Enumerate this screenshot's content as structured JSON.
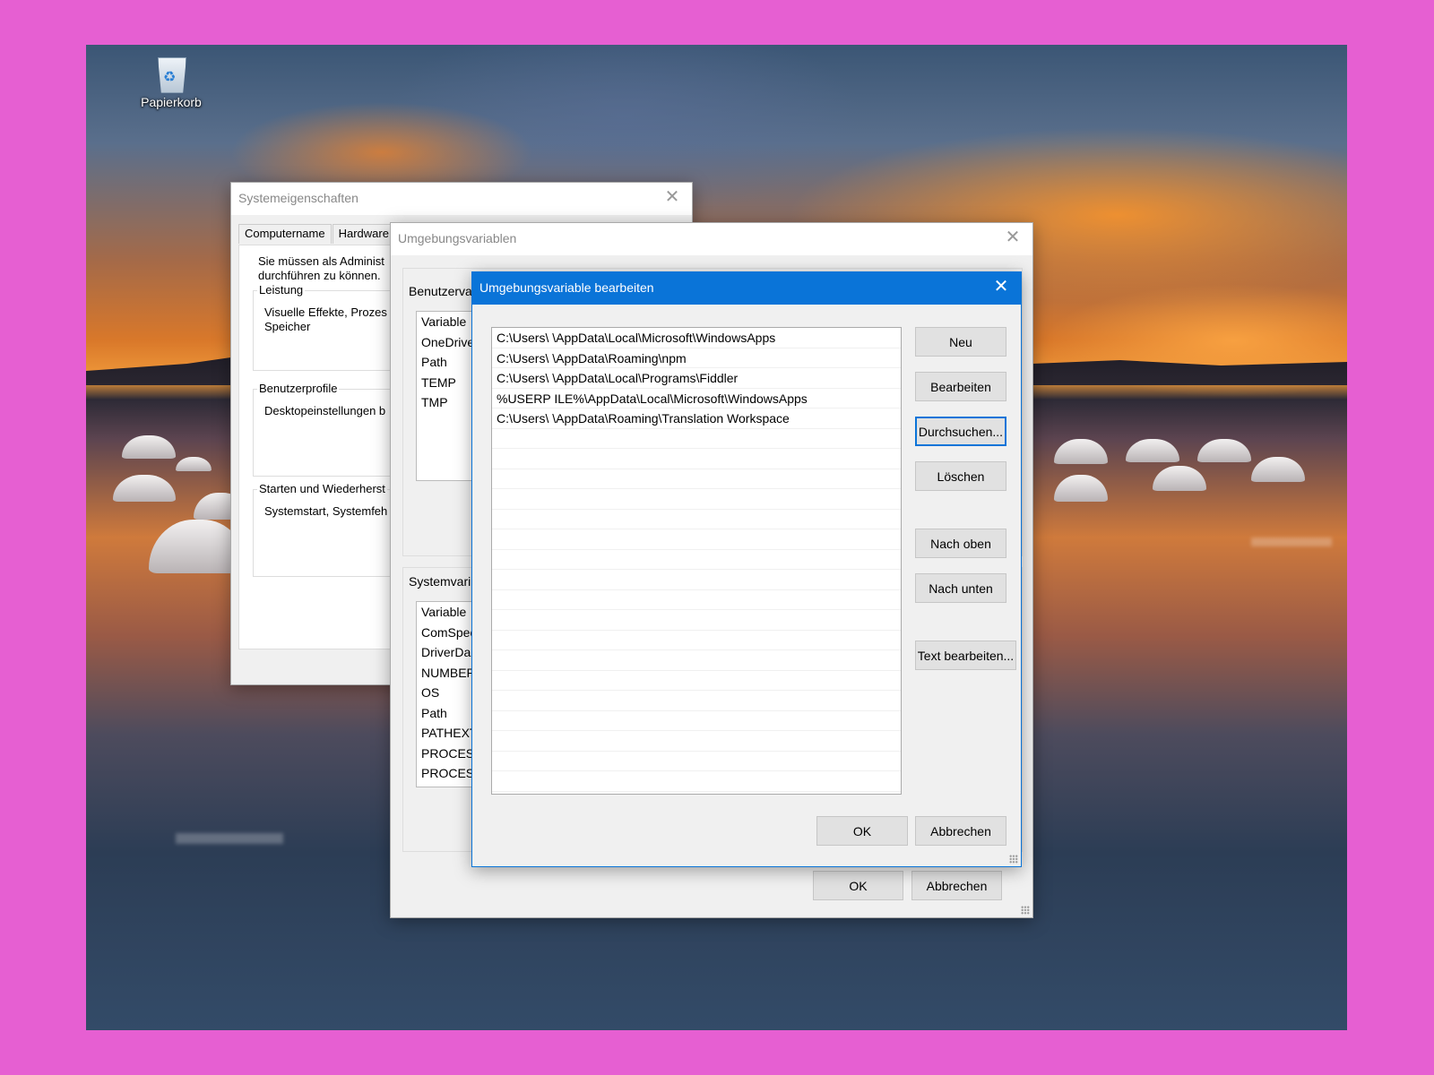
{
  "desktop": {
    "recycle_bin_label": "Papierkorb"
  },
  "system_properties": {
    "title": "Systemeigenschaften",
    "tabs": [
      "Computername",
      "Hardware"
    ],
    "admin_note_line1": "Sie müssen als Administ",
    "admin_note_line2": "durchführen zu können.",
    "groups": [
      {
        "label": "Leistung",
        "text_line1": "Visuelle Effekte, Prozes",
        "text_line2": "Speicher"
      },
      {
        "label": "Benutzerprofile",
        "text_line1": "Desktopeinstellungen b"
      },
      {
        "label": "Starten und Wiederherst",
        "text_line1": "Systemstart, Systemfeh"
      }
    ]
  },
  "env_vars": {
    "title": "Umgebungsvariablen",
    "user_label": "Benutzerva",
    "user_header": "Variable",
    "user_vars": [
      "OneDrive",
      "Path",
      "TEMP",
      "TMP"
    ],
    "system_label": "Systemvari",
    "system_header": "Variable",
    "system_vars": [
      "ComSpec",
      "DriverDa",
      "NUMBER",
      "OS",
      "Path",
      "PATHEXT",
      "PROCESS",
      "PROCESS"
    ],
    "ok_label": "OK",
    "cancel_label": "Abbrechen"
  },
  "edit_dialog": {
    "title": "Umgebungsvariable bearbeiten",
    "paths": [
      "C:\\Users\\        \\AppData\\Local\\Microsoft\\WindowsApps",
      "C:\\Users\\        \\AppData\\Roaming\\npm",
      "C:\\Users\\        \\AppData\\Local\\Programs\\Fiddler",
      "%USERP          ILE%\\AppData\\Local\\Microsoft\\WindowsApps",
      "C:\\Users\\        \\AppData\\Roaming\\Translation Workspace"
    ],
    "buttons": {
      "new": "Neu",
      "edit": "Bearbeiten",
      "browse": "Durchsuchen...",
      "delete": "Löschen",
      "up": "Nach oben",
      "down": "Nach unten",
      "edit_text": "Text bearbeiten..."
    },
    "ok_label": "OK",
    "cancel_label": "Abbrechen"
  }
}
